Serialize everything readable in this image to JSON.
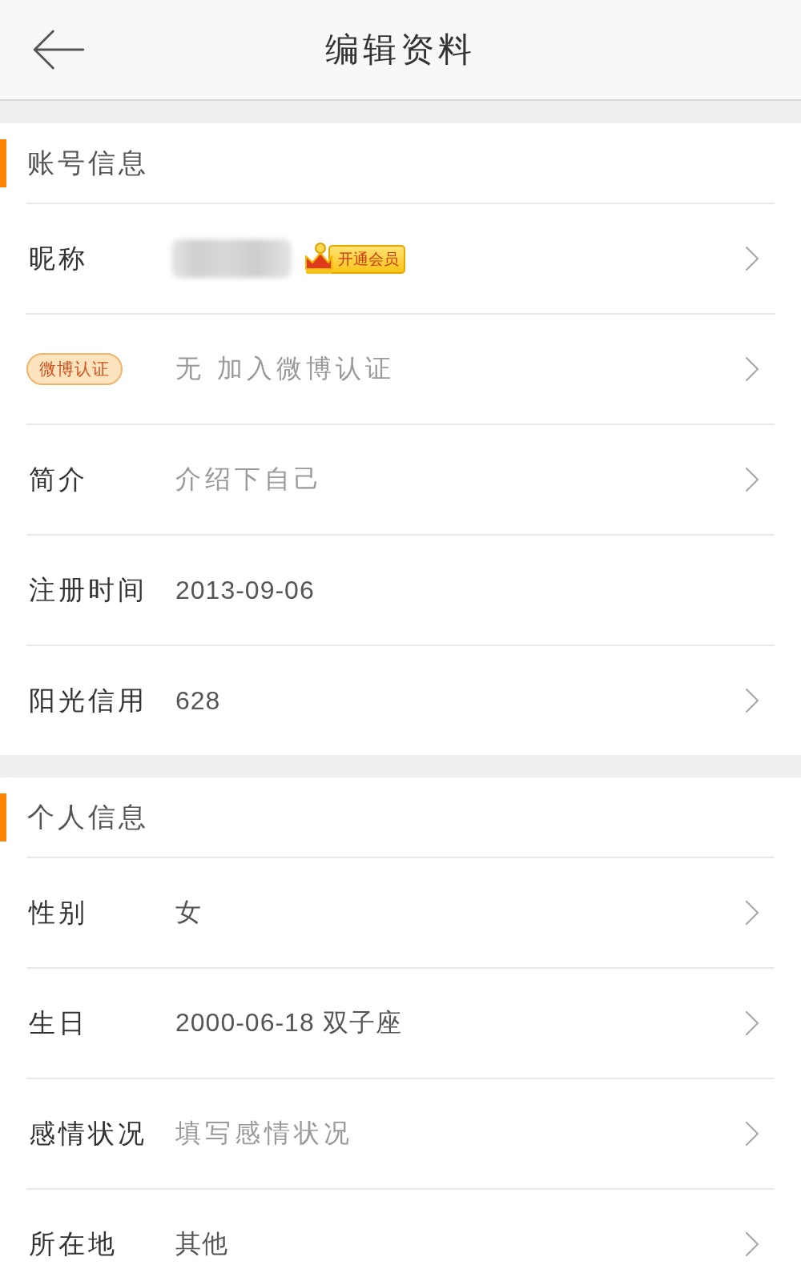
{
  "header": {
    "title": "编辑资料"
  },
  "sections": [
    {
      "title": "账号信息",
      "rows": [
        {
          "kind": "nickname",
          "label": "昵称",
          "badge": "开通会员",
          "navigable": true
        },
        {
          "kind": "verification",
          "badge": "微博认证",
          "placeholder": "无 加入微博认证",
          "navigable": true
        },
        {
          "kind": "field",
          "label": "简介",
          "placeholder": "介绍下自己",
          "navigable": true
        },
        {
          "kind": "field",
          "label": "注册时间",
          "value": "2013-09-06",
          "navigable": false
        },
        {
          "kind": "field",
          "label": "阳光信用",
          "value": "628",
          "navigable": true
        }
      ]
    },
    {
      "title": "个人信息",
      "rows": [
        {
          "kind": "field",
          "label": "性别",
          "value": "女",
          "navigable": true
        },
        {
          "kind": "field",
          "label": "生日",
          "value": "2000-06-18 双子座",
          "navigable": true
        },
        {
          "kind": "field",
          "label": "感情状况",
          "placeholder": "填写感情状况",
          "navigable": true
        },
        {
          "kind": "field",
          "label": "所在地",
          "value": "其他",
          "navigable": true
        }
      ]
    }
  ]
}
